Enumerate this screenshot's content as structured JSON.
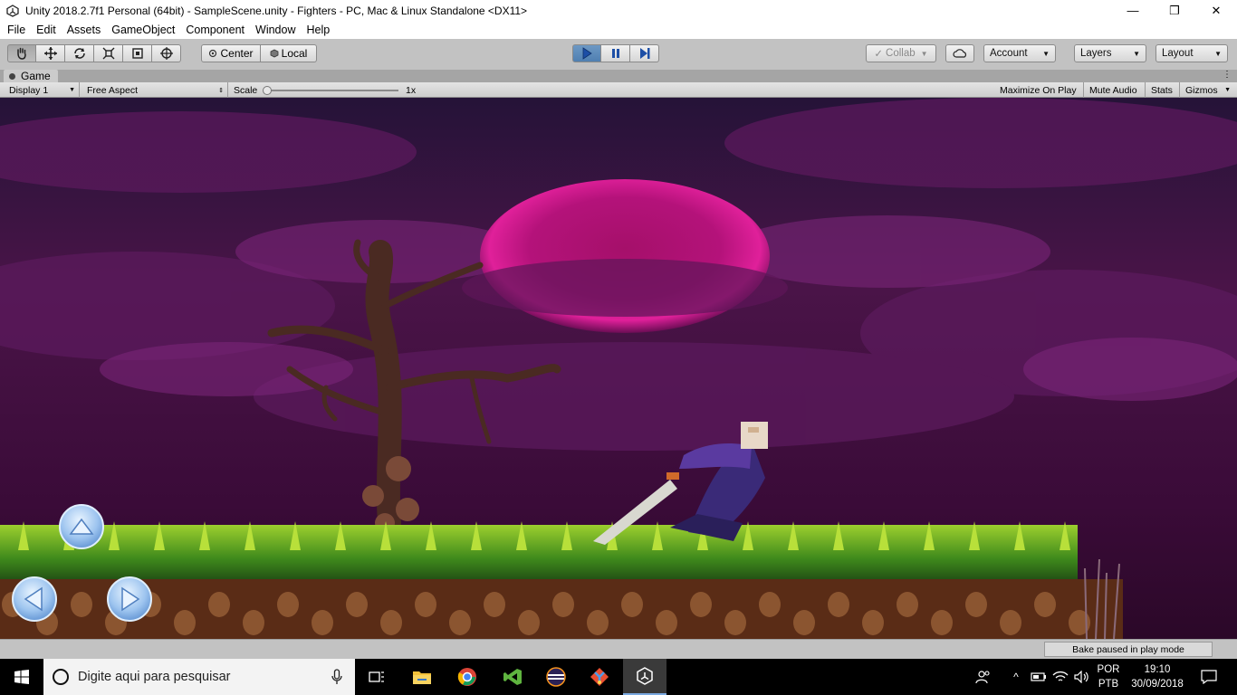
{
  "window": {
    "title": "Unity 2018.2.7f1 Personal (64bit) - SampleScene.unity - Fighters - PC, Mac & Linux Standalone <DX11>",
    "minimize_glyph": "—",
    "maximize_glyph": "❐",
    "close_glyph": "✕"
  },
  "menu": [
    "File",
    "Edit",
    "Assets",
    "GameObject",
    "Component",
    "Window",
    "Help"
  ],
  "toolbar": {
    "tools": [
      "hand-tool-icon",
      "move-tool-icon",
      "rotate-tool-icon",
      "scale-tool-icon",
      "rect-tool-icon",
      "transform-tool-icon"
    ],
    "pivot_label": "Center",
    "space_label": "Local",
    "play_icons": [
      "play-icon",
      "pause-icon",
      "step-icon"
    ],
    "play_state": "playing-paused",
    "collab_label": "Collab",
    "account_label": "Account",
    "layers_label": "Layers",
    "layout_label": "Layout"
  },
  "game_view": {
    "tab_label": "Game",
    "display_label": "Display 1",
    "aspect_label": "Free Aspect",
    "scale_label": "Scale",
    "scale_value": "1x",
    "scale_fraction": 0.0,
    "maximize_label": "Maximize On Play",
    "mute_label": "Mute Audio",
    "stats_label": "Stats",
    "gizmos_label": "Gizmos"
  },
  "touch_controls": [
    "up-arrow-button",
    "left-arrow-button",
    "right-arrow-button"
  ],
  "status": {
    "bake_text": "Bake paused in play mode"
  },
  "taskbar": {
    "search_placeholder": "Digite aqui para pesquisar",
    "apps": [
      "task-view-icon",
      "file-explorer-icon",
      "chrome-icon",
      "visual-studio-icon",
      "eclipse-icon",
      "git-icon",
      "unity-icon"
    ],
    "lang_top": "POR",
    "lang_bottom": "PTB",
    "time": "19:10",
    "date": "30/09/2018"
  },
  "colors": {
    "sky_dark": "#2e0a2c",
    "moon": "#d3128a",
    "grass": "#7fb32a",
    "dirt": "#6b3418",
    "play_active": "#4f7fb1"
  }
}
